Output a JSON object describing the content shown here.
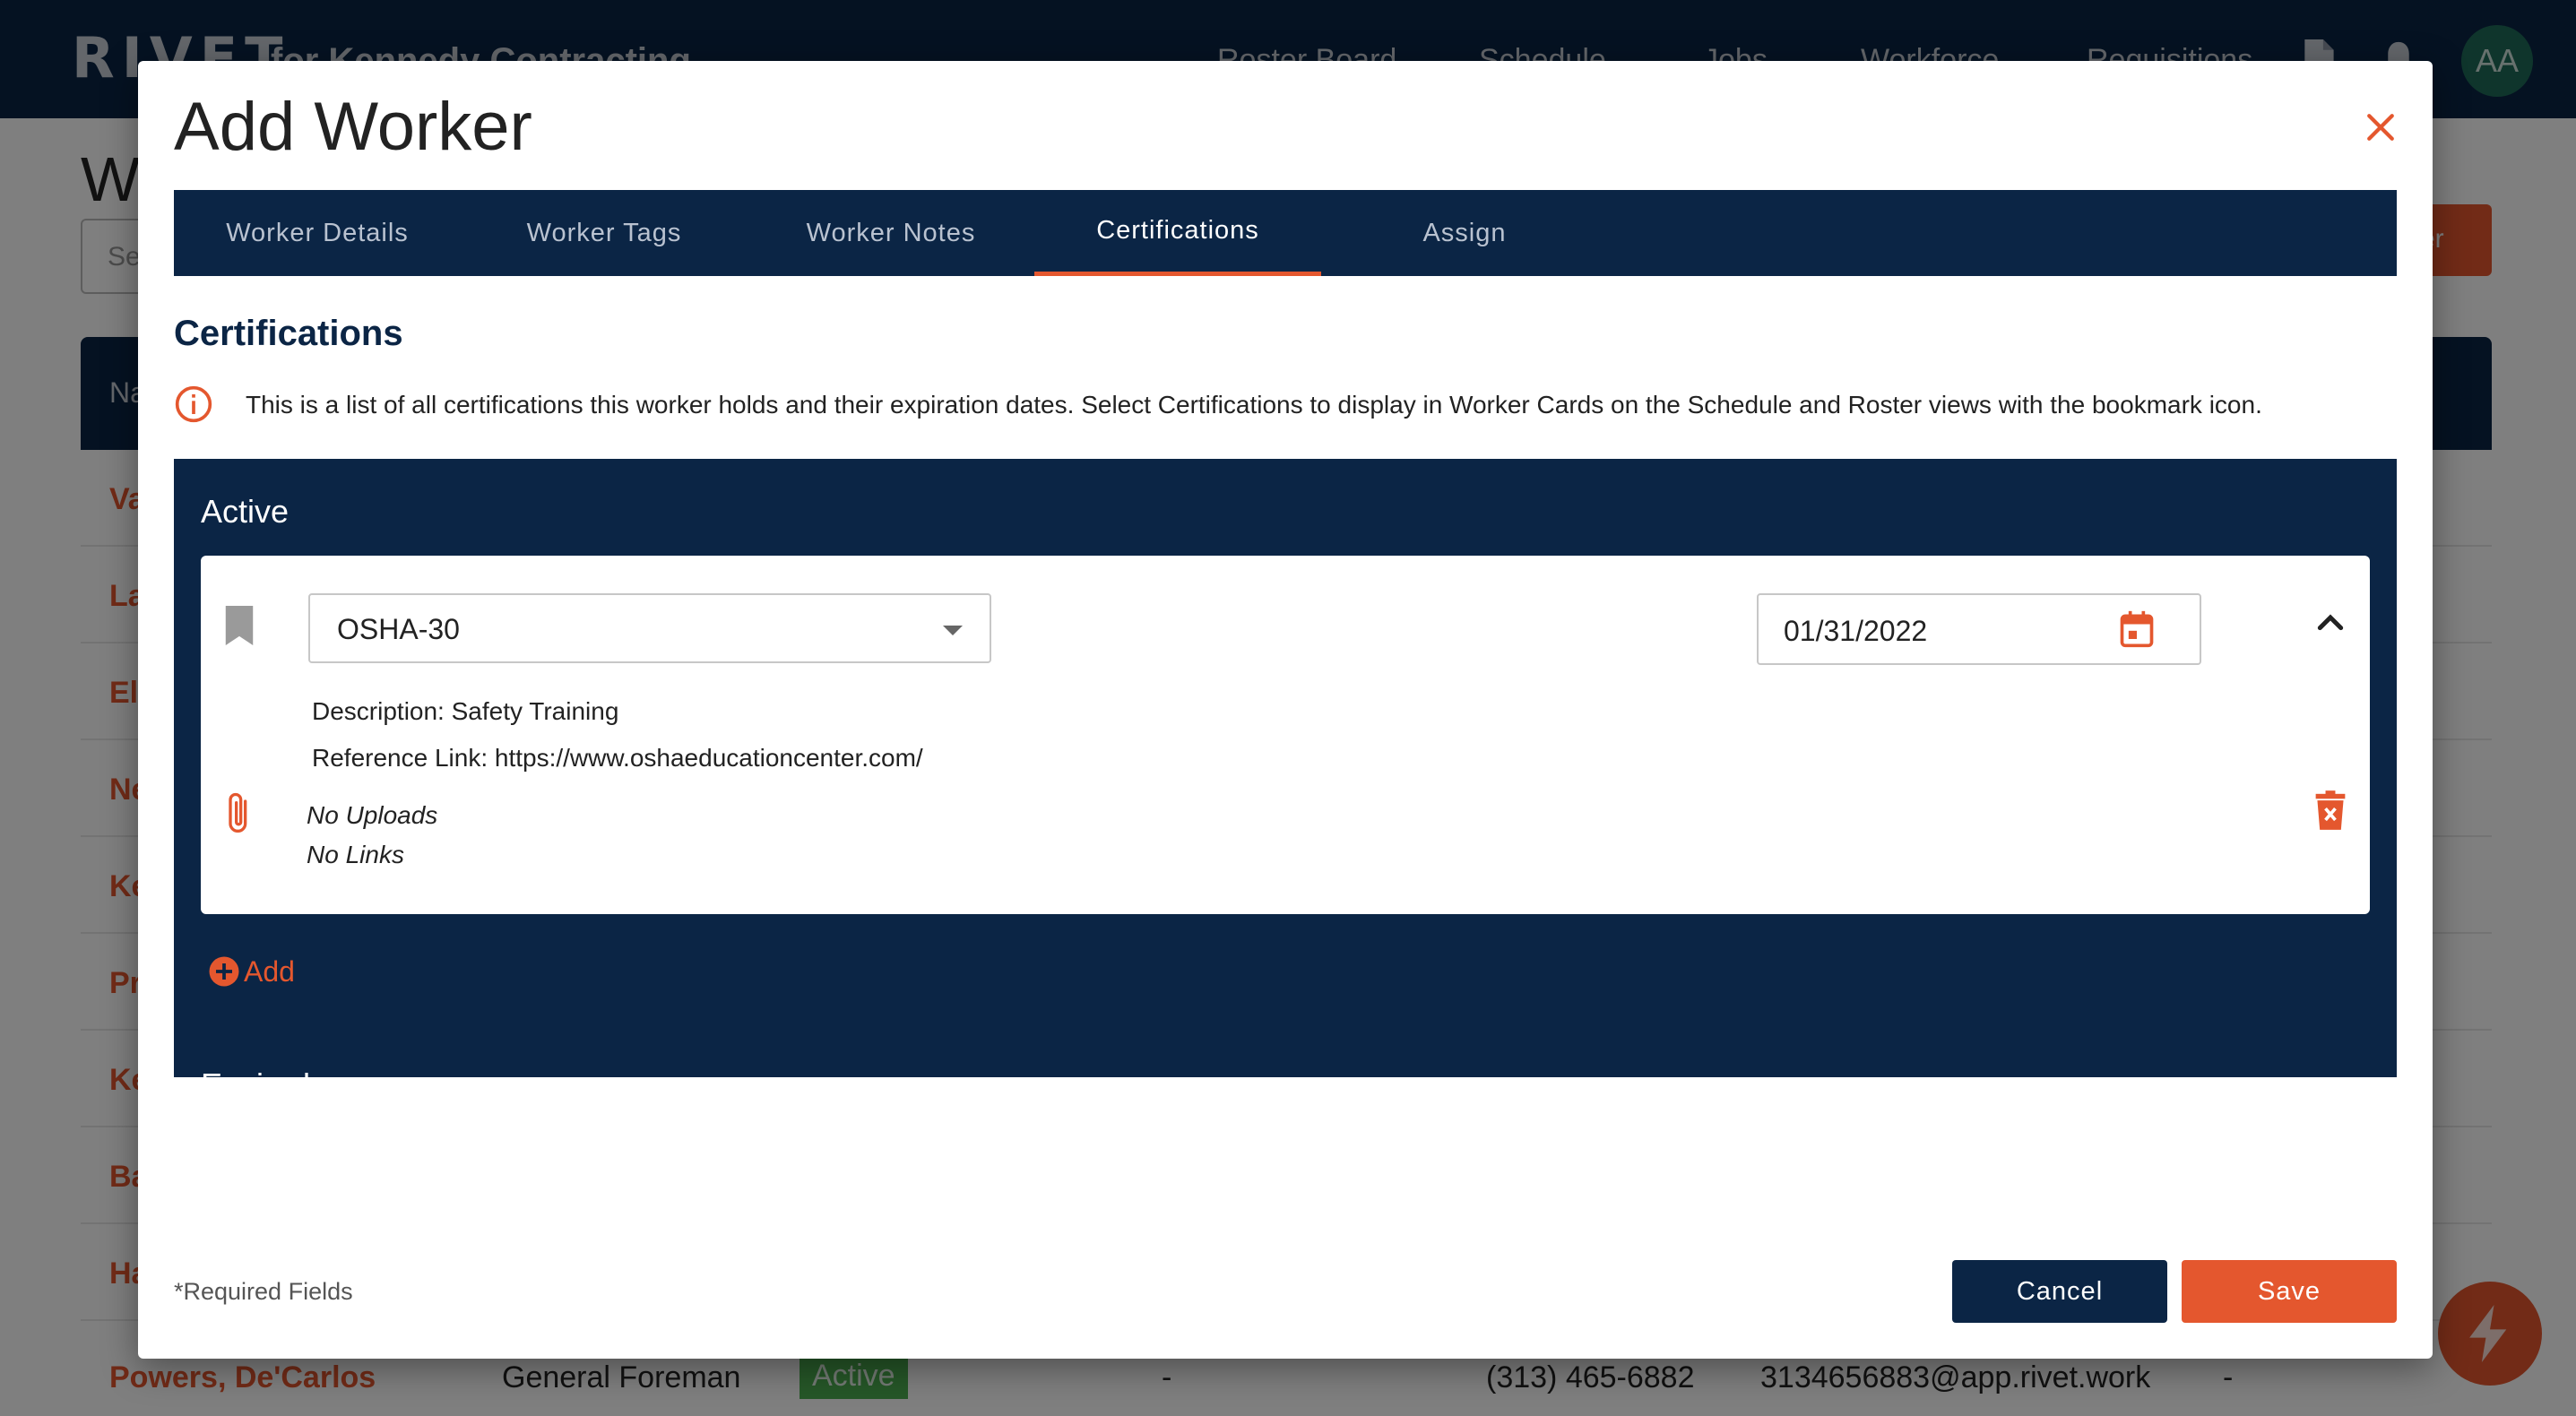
{
  "app": {
    "logo": "RIVET",
    "company": "for Kennedy Contracting",
    "nav": [
      "Roster Board",
      "Schedule",
      "Jobs",
      "Workforce",
      "Requisitions"
    ],
    "avatar_initials": "AA",
    "page_title_partial": "W",
    "search_placeholder_partial": "Se",
    "header_button_partial": "er",
    "table_header_partial": "Na",
    "row_names_partial": [
      "Va",
      "La",
      "El",
      "Ne",
      "Ke",
      "Pr",
      "Ke",
      "Ba",
      "Ha"
    ],
    "last_row": {
      "name": "Powers, De'Carlos",
      "role": "General Foreman",
      "status": "Active",
      "col4": "-",
      "phone": "(313) 465-6882",
      "email": "3134656883@app.rivet.work",
      "col7": "-"
    }
  },
  "modal": {
    "title": "Add Worker",
    "tabs": [
      "Worker Details",
      "Worker Tags",
      "Worker Notes",
      "Certifications",
      "Assign"
    ],
    "active_tab": "Certifications",
    "section_title": "Certifications",
    "info_text": "This is a list of all certifications this worker holds and their expiration dates. Select Certifications to display in Worker Cards on the Schedule and Roster views with the bookmark icon.",
    "active_label": "Active",
    "certification": {
      "name": "OSHA-30",
      "expiration": "01/31/2022",
      "description": "Description: Safety Training",
      "reference_link": "Reference Link: https://www.oshaeducationcenter.com/",
      "uploads": "No Uploads",
      "links": "No Links"
    },
    "add_label": "Add",
    "expired_label": "Expired",
    "required_note": "*Required Fields",
    "cancel_label": "Cancel",
    "save_label": "Save"
  },
  "colors": {
    "navy": "#0b2545",
    "accent": "#e4572e"
  }
}
